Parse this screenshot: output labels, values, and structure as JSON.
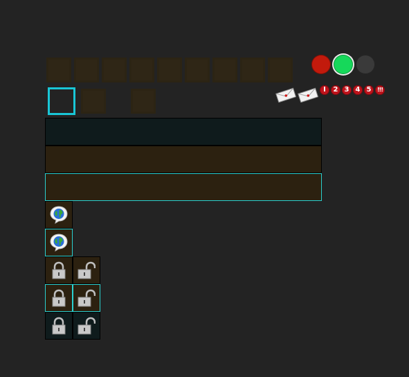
{
  "hud": {
    "status_colors": {
      "red": "#c21a0c",
      "green": "#16d85a",
      "gray": "#3a3a3a"
    },
    "badges": [
      "I",
      "2",
      "3",
      "4",
      "5",
      "!!!"
    ]
  },
  "icons": {
    "envelope": "envelope-icon",
    "globe_speech": "globe-speech-bubble-icon",
    "lock_closed": "padlock-closed-icon",
    "lock_open": "padlock-open-icon"
  },
  "colors": {
    "background": "#232323",
    "slot_brown": "#2c2414",
    "bar_dark": "#0f1b1c",
    "bar_brown": "#2c2110",
    "highlight": "#2ad0d0",
    "selection": "#19c6d6"
  }
}
